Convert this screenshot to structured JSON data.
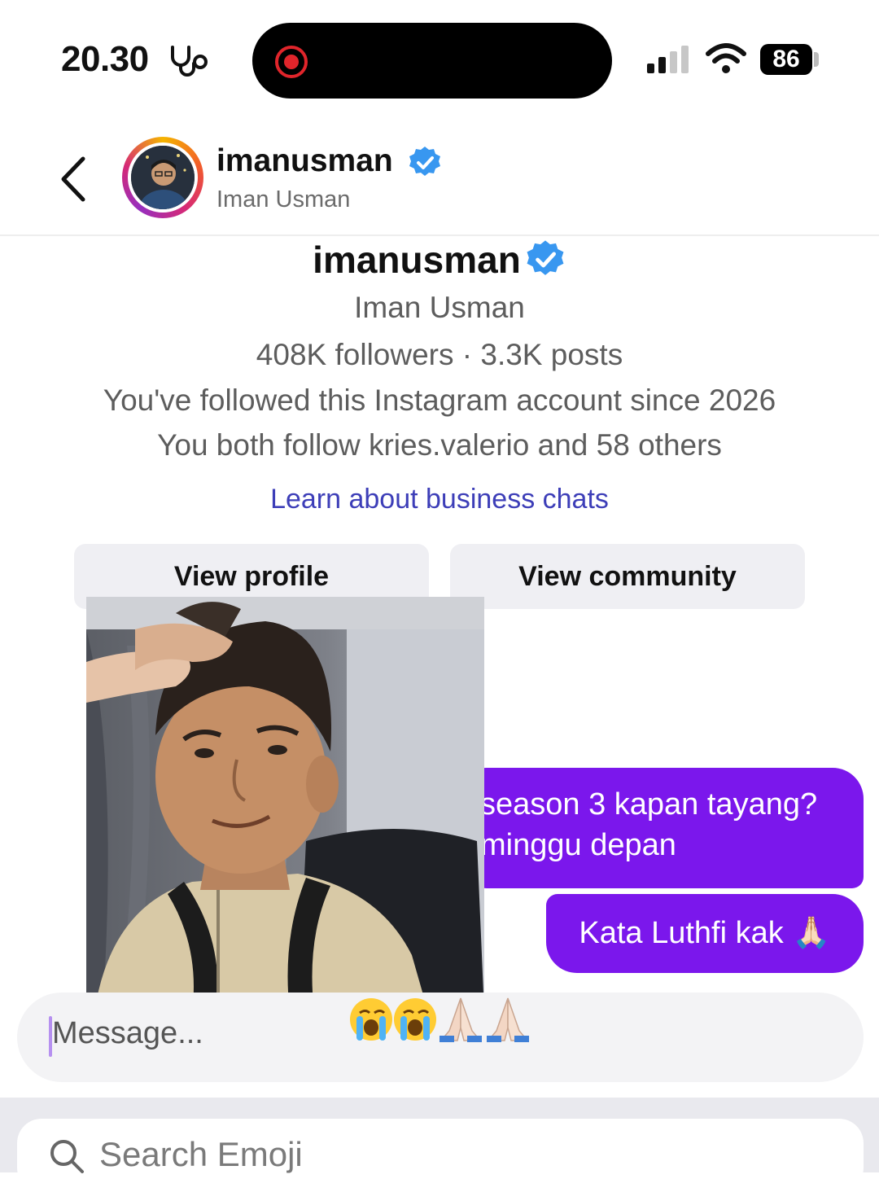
{
  "status_bar": {
    "time": "20.30",
    "battery": "86"
  },
  "header": {
    "username": "imanusman",
    "display_name": "Iman Usman",
    "back_icon": "chevron-left-icon",
    "verified_icon": "verified-badge-icon"
  },
  "profile_card": {
    "username": "imanusman",
    "display_name": "Iman Usman",
    "stats": "408K followers · 3.3K posts",
    "followed_since": "You've followed this Instagram account since 2026",
    "mutual": "You both follow kries.valerio and 58 others",
    "learn_link": "Learn about business chats",
    "view_profile": "View profile",
    "view_community": "View community"
  },
  "messages": [
    {
      "line1": "season 3 kapan tayang?",
      "line2": "minggu depan"
    },
    {
      "text": "Kata Luthfi kak 🙏🏻"
    }
  ],
  "composer": {
    "placeholder": "Message...",
    "overlay_emojis": [
      "loudly-crying-face",
      "loudly-crying-face",
      "folded-hands",
      "folded-hands"
    ]
  },
  "keyboard": {
    "search_placeholder": "Search Emoji"
  },
  "colors": {
    "bubble": "#7b17ec",
    "link": "#3d3eb8",
    "verified": "#3897f0"
  }
}
